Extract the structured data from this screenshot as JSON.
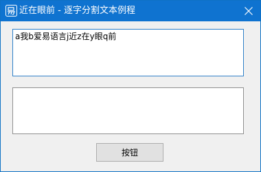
{
  "window": {
    "title": "近在眼前 - 逐字分割文本例程",
    "title_color": "#0f73d0"
  },
  "icons": {
    "app": "app-logo-icon",
    "close": "close-icon"
  },
  "editor_top": {
    "value": "a我b爱易语言j近z在y眼q前"
  },
  "editor_bottom": {
    "value": ""
  },
  "button": {
    "label": "按钮"
  }
}
